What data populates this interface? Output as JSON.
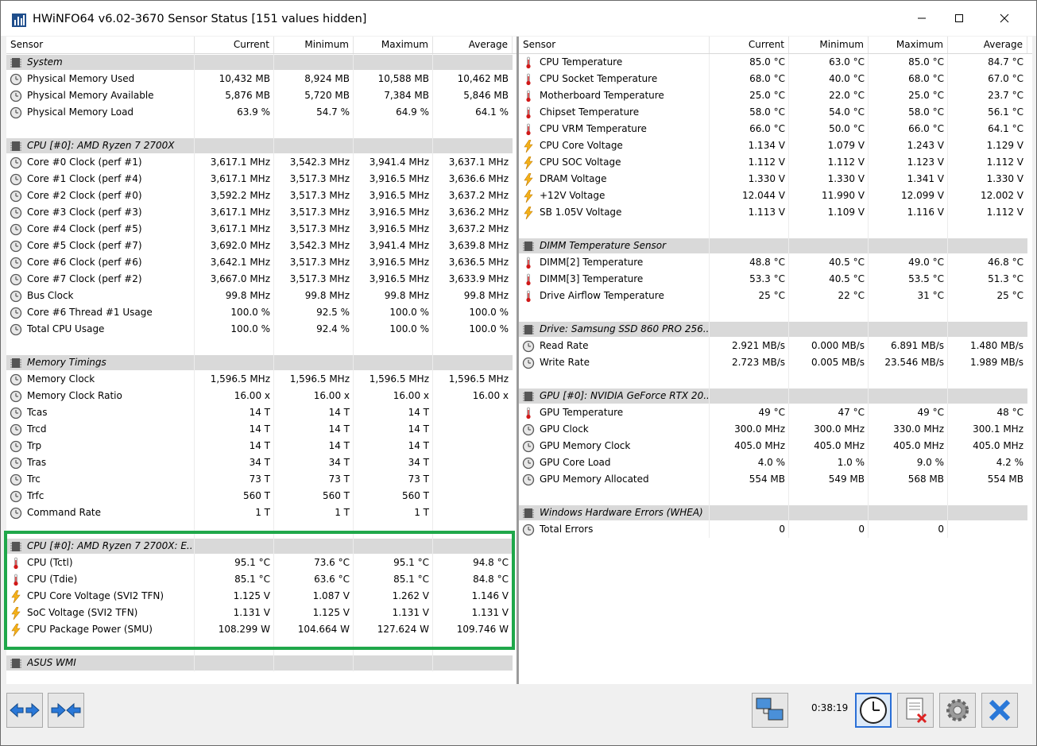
{
  "window": {
    "title": "HWiNFO64 v6.02-3670 Sensor Status [151 values hidden]"
  },
  "columns": {
    "sensor": "Sensor",
    "current": "Current",
    "minimum": "Minimum",
    "maximum": "Maximum",
    "average": "Average"
  },
  "left_rows": [
    {
      "type": "group",
      "label": "System"
    },
    {
      "type": "item",
      "icon": "clock",
      "label": "Physical Memory Used",
      "cur": "10,432 MB",
      "min": "8,924 MB",
      "max": "10,588 MB",
      "avg": "10,462 MB"
    },
    {
      "type": "item",
      "icon": "clock",
      "label": "Physical Memory Available",
      "cur": "5,876 MB",
      "min": "5,720 MB",
      "max": "7,384 MB",
      "avg": "5,846 MB"
    },
    {
      "type": "item",
      "icon": "clock",
      "label": "Physical Memory Load",
      "cur": "63.9 %",
      "min": "54.7 %",
      "max": "64.9 %",
      "avg": "64.1 %"
    },
    {
      "type": "blank"
    },
    {
      "type": "group",
      "label": "CPU [#0]: AMD Ryzen 7 2700X"
    },
    {
      "type": "item",
      "icon": "clock",
      "label": "Core #0 Clock (perf #1)",
      "cur": "3,617.1 MHz",
      "min": "3,542.3 MHz",
      "max": "3,941.4 MHz",
      "avg": "3,637.1 MHz"
    },
    {
      "type": "item",
      "icon": "clock",
      "label": "Core #1 Clock (perf #4)",
      "cur": "3,617.1 MHz",
      "min": "3,517.3 MHz",
      "max": "3,916.5 MHz",
      "avg": "3,636.6 MHz"
    },
    {
      "type": "item",
      "icon": "clock",
      "label": "Core #2 Clock (perf #0)",
      "cur": "3,592.2 MHz",
      "min": "3,517.3 MHz",
      "max": "3,916.5 MHz",
      "avg": "3,637.2 MHz"
    },
    {
      "type": "item",
      "icon": "clock",
      "label": "Core #3 Clock (perf #3)",
      "cur": "3,617.1 MHz",
      "min": "3,517.3 MHz",
      "max": "3,916.5 MHz",
      "avg": "3,636.2 MHz"
    },
    {
      "type": "item",
      "icon": "clock",
      "label": "Core #4 Clock (perf #5)",
      "cur": "3,617.1 MHz",
      "min": "3,517.3 MHz",
      "max": "3,916.5 MHz",
      "avg": "3,637.2 MHz"
    },
    {
      "type": "item",
      "icon": "clock",
      "label": "Core #5 Clock (perf #7)",
      "cur": "3,692.0 MHz",
      "min": "3,542.3 MHz",
      "max": "3,941.4 MHz",
      "avg": "3,639.8 MHz"
    },
    {
      "type": "item",
      "icon": "clock",
      "label": "Core #6 Clock (perf #6)",
      "cur": "3,642.1 MHz",
      "min": "3,517.3 MHz",
      "max": "3,916.5 MHz",
      "avg": "3,636.5 MHz"
    },
    {
      "type": "item",
      "icon": "clock",
      "label": "Core #7 Clock (perf #2)",
      "cur": "3,667.0 MHz",
      "min": "3,517.3 MHz",
      "max": "3,916.5 MHz",
      "avg": "3,633.9 MHz"
    },
    {
      "type": "item",
      "icon": "clock",
      "label": "Bus Clock",
      "cur": "99.8 MHz",
      "min": "99.8 MHz",
      "max": "99.8 MHz",
      "avg": "99.8 MHz"
    },
    {
      "type": "item",
      "icon": "clock",
      "label": "Core #6 Thread #1 Usage",
      "cur": "100.0 %",
      "min": "92.5 %",
      "max": "100.0 %",
      "avg": "100.0 %"
    },
    {
      "type": "item",
      "icon": "clock",
      "label": "Total CPU Usage",
      "cur": "100.0 %",
      "min": "92.4 %",
      "max": "100.0 %",
      "avg": "100.0 %"
    },
    {
      "type": "blank"
    },
    {
      "type": "group",
      "label": "Memory Timings"
    },
    {
      "type": "item",
      "icon": "clock",
      "label": "Memory Clock",
      "cur": "1,596.5 MHz",
      "min": "1,596.5 MHz",
      "max": "1,596.5 MHz",
      "avg": "1,596.5 MHz"
    },
    {
      "type": "item",
      "icon": "clock",
      "label": "Memory Clock Ratio",
      "cur": "16.00 x",
      "min": "16.00 x",
      "max": "16.00 x",
      "avg": "16.00 x"
    },
    {
      "type": "item",
      "icon": "clock",
      "label": "Tcas",
      "cur": "14 T",
      "min": "14 T",
      "max": "14 T",
      "avg": ""
    },
    {
      "type": "item",
      "icon": "clock",
      "label": "Trcd",
      "cur": "14 T",
      "min": "14 T",
      "max": "14 T",
      "avg": ""
    },
    {
      "type": "item",
      "icon": "clock",
      "label": "Trp",
      "cur": "14 T",
      "min": "14 T",
      "max": "14 T",
      "avg": ""
    },
    {
      "type": "item",
      "icon": "clock",
      "label": "Tras",
      "cur": "34 T",
      "min": "34 T",
      "max": "34 T",
      "avg": ""
    },
    {
      "type": "item",
      "icon": "clock",
      "label": "Trc",
      "cur": "73 T",
      "min": "73 T",
      "max": "73 T",
      "avg": ""
    },
    {
      "type": "item",
      "icon": "clock",
      "label": "Trfc",
      "cur": "560 T",
      "min": "560 T",
      "max": "560 T",
      "avg": ""
    },
    {
      "type": "item",
      "icon": "clock",
      "label": "Command Rate",
      "cur": "1 T",
      "min": "1 T",
      "max": "1 T",
      "avg": ""
    },
    {
      "type": "blank"
    },
    {
      "type": "group",
      "label": "CPU [#0]: AMD Ryzen 7 2700X: E..."
    },
    {
      "type": "item",
      "icon": "temp",
      "label": "CPU (Tctl)",
      "cur": "95.1 °C",
      "min": "73.6 °C",
      "max": "95.1 °C",
      "avg": "94.8 °C"
    },
    {
      "type": "item",
      "icon": "temp",
      "label": "CPU (Tdie)",
      "cur": "85.1 °C",
      "min": "63.6 °C",
      "max": "85.1 °C",
      "avg": "84.8 °C"
    },
    {
      "type": "item",
      "icon": "volt",
      "label": "CPU Core Voltage (SVI2 TFN)",
      "cur": "1.125 V",
      "min": "1.087 V",
      "max": "1.262 V",
      "avg": "1.146 V"
    },
    {
      "type": "item",
      "icon": "volt",
      "label": "SoC Voltage (SVI2 TFN)",
      "cur": "1.131 V",
      "min": "1.125 V",
      "max": "1.131 V",
      "avg": "1.131 V"
    },
    {
      "type": "item",
      "icon": "volt",
      "label": "CPU Package Power (SMU)",
      "cur": "108.299 W",
      "min": "104.664 W",
      "max": "127.624 W",
      "avg": "109.746 W"
    },
    {
      "type": "blank"
    },
    {
      "type": "group",
      "label": "ASUS WMI"
    }
  ],
  "right_rows": [
    {
      "type": "item",
      "icon": "temp",
      "label": "CPU Temperature",
      "cur": "85.0 °C",
      "min": "63.0 °C",
      "max": "85.0 °C",
      "avg": "84.7 °C"
    },
    {
      "type": "item",
      "icon": "temp",
      "label": "CPU Socket Temperature",
      "cur": "68.0 °C",
      "min": "40.0 °C",
      "max": "68.0 °C",
      "avg": "67.0 °C"
    },
    {
      "type": "item",
      "icon": "temp",
      "label": "Motherboard Temperature",
      "cur": "25.0 °C",
      "min": "22.0 °C",
      "max": "25.0 °C",
      "avg": "23.7 °C"
    },
    {
      "type": "item",
      "icon": "temp",
      "label": "Chipset Temperature",
      "cur": "58.0 °C",
      "min": "54.0 °C",
      "max": "58.0 °C",
      "avg": "56.1 °C"
    },
    {
      "type": "item",
      "icon": "temp",
      "label": "CPU VRM Temperature",
      "cur": "66.0 °C",
      "min": "50.0 °C",
      "max": "66.0 °C",
      "avg": "64.1 °C"
    },
    {
      "type": "item",
      "icon": "volt",
      "label": "CPU Core Voltage",
      "cur": "1.134 V",
      "min": "1.079 V",
      "max": "1.243 V",
      "avg": "1.129 V"
    },
    {
      "type": "item",
      "icon": "volt",
      "label": "CPU SOC Voltage",
      "cur": "1.112 V",
      "min": "1.112 V",
      "max": "1.123 V",
      "avg": "1.112 V"
    },
    {
      "type": "item",
      "icon": "volt",
      "label": "DRAM Voltage",
      "cur": "1.330 V",
      "min": "1.330 V",
      "max": "1.341 V",
      "avg": "1.330 V"
    },
    {
      "type": "item",
      "icon": "volt",
      "label": "+12V Voltage",
      "cur": "12.044 V",
      "min": "11.990 V",
      "max": "12.099 V",
      "avg": "12.002 V"
    },
    {
      "type": "item",
      "icon": "volt",
      "label": "SB 1.05V Voltage",
      "cur": "1.113 V",
      "min": "1.109 V",
      "max": "1.116 V",
      "avg": "1.112 V"
    },
    {
      "type": "blank"
    },
    {
      "type": "group",
      "label": "DIMM Temperature Sensor"
    },
    {
      "type": "item",
      "icon": "temp",
      "label": "DIMM[2] Temperature",
      "cur": "48.8 °C",
      "min": "40.5 °C",
      "max": "49.0 °C",
      "avg": "46.8 °C"
    },
    {
      "type": "item",
      "icon": "temp",
      "label": "DIMM[3] Temperature",
      "cur": "53.3 °C",
      "min": "40.5 °C",
      "max": "53.5 °C",
      "avg": "51.3 °C"
    },
    {
      "type": "item",
      "icon": "temp",
      "label": "Drive Airflow Temperature",
      "cur": "25 °C",
      "min": "22 °C",
      "max": "31 °C",
      "avg": "25 °C"
    },
    {
      "type": "blank"
    },
    {
      "type": "group",
      "label": "Drive: Samsung SSD 860 PRO 256..."
    },
    {
      "type": "item",
      "icon": "clock",
      "label": "Read Rate",
      "cur": "2.921 MB/s",
      "min": "0.000 MB/s",
      "max": "6.891 MB/s",
      "avg": "1.480 MB/s"
    },
    {
      "type": "item",
      "icon": "clock",
      "label": "Write Rate",
      "cur": "2.723 MB/s",
      "min": "0.005 MB/s",
      "max": "23.546 MB/s",
      "avg": "1.989 MB/s"
    },
    {
      "type": "blank"
    },
    {
      "type": "group",
      "label": "GPU [#0]: NVIDIA GeForce RTX 20..."
    },
    {
      "type": "item",
      "icon": "temp",
      "label": "GPU Temperature",
      "cur": "49 °C",
      "min": "47 °C",
      "max": "49 °C",
      "avg": "48 °C"
    },
    {
      "type": "item",
      "icon": "clock",
      "label": "GPU Clock",
      "cur": "300.0 MHz",
      "min": "300.0 MHz",
      "max": "330.0 MHz",
      "avg": "300.1 MHz"
    },
    {
      "type": "item",
      "icon": "clock",
      "label": "GPU Memory Clock",
      "cur": "405.0 MHz",
      "min": "405.0 MHz",
      "max": "405.0 MHz",
      "avg": "405.0 MHz"
    },
    {
      "type": "item",
      "icon": "clock",
      "label": "GPU Core Load",
      "cur": "4.0 %",
      "min": "1.0 %",
      "max": "9.0 %",
      "avg": "4.2 %"
    },
    {
      "type": "item",
      "icon": "clock",
      "label": "GPU Memory Allocated",
      "cur": "554 MB",
      "min": "549 MB",
      "max": "568 MB",
      "avg": "554 MB"
    },
    {
      "type": "blank"
    },
    {
      "type": "group",
      "label": "Windows Hardware Errors (WHEA)"
    },
    {
      "type": "item",
      "icon": "clock",
      "label": "Total Errors",
      "cur": "0",
      "min": "0",
      "max": "0",
      "avg": ""
    }
  ],
  "bottom": {
    "timer": "0:38:19"
  },
  "colors": {
    "highlight": "#1fa74a",
    "group_bg": "#d9d9d9",
    "accent": "#2a6fd6"
  }
}
